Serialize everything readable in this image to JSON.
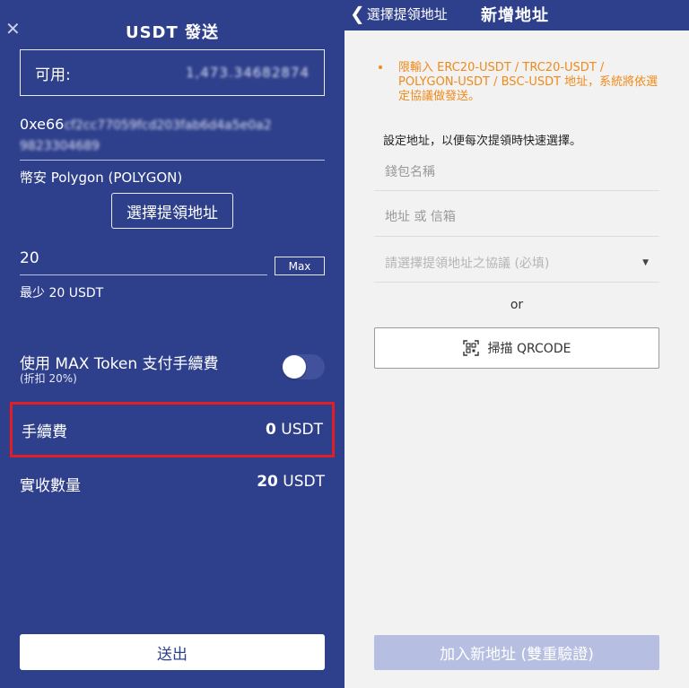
{
  "send": {
    "close_icon": "close-icon",
    "title": "USDT 發送",
    "available_label": "可用:",
    "available_value": "1,473.34682874",
    "address_prefix": "0xe66",
    "address_rest": "cf2cc77059fcd203fab6d4a5e0a2",
    "address_line2": "9823304689",
    "network": "幣安 Polygon (POLYGON)",
    "select_address_button": "選擇提領地址",
    "amount_value": "20",
    "max_button": "Max",
    "min_note": "最少 20 USDT",
    "max_token_label": "使用 MAX Token 支付手續費",
    "max_token_sub": "(折扣 20%)",
    "max_token_toggle": "off",
    "fee_label": "手續費",
    "fee_amount": "0",
    "fee_unit": "USDT",
    "received_label": "實收數量",
    "received_amount": "20",
    "received_unit": "USDT",
    "send_button": "送出",
    "colors": {
      "panel_bg": "#2e3f8c",
      "highlight_border": "#e01e23"
    }
  },
  "add_address": {
    "back_label": "選擇提領地址",
    "title": "新增地址",
    "warning": "限輸入 ERC20-USDT / TRC20-USDT / POLYGON-USDT / BSC-USDT 地址，系統將依選定協議做發送。",
    "hint": "設定地址，以便每次提領時快速選擇。",
    "wallet_name_placeholder": "錢包名稱",
    "address_placeholder": "地址 或 信箱",
    "protocol_placeholder": "請選擇提領地址之協議 (必填)",
    "or_text": "or",
    "scan_button": "掃描 QRCODE",
    "add_button": "加入新地址 (雙重驗證)",
    "colors": {
      "warning": "#ef8a1a",
      "add_button_bg": "#b6bfe1"
    }
  }
}
